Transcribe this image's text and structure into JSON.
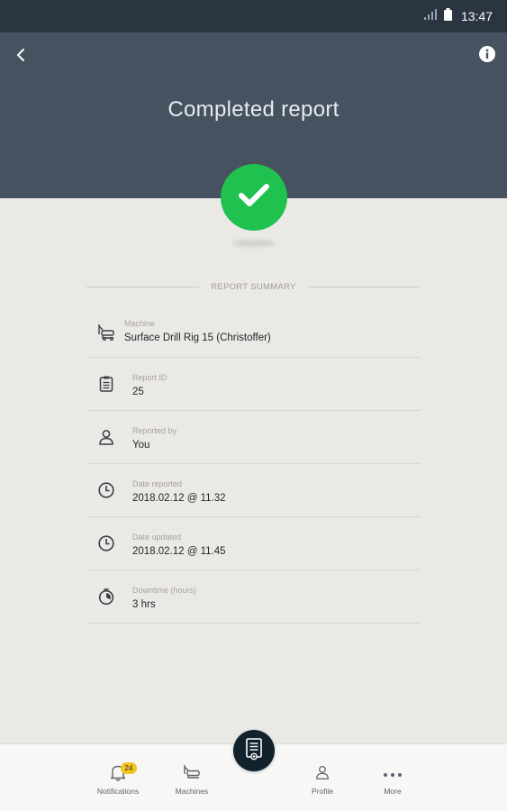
{
  "status_bar": {
    "time": "13:47"
  },
  "header": {
    "title": "Completed report"
  },
  "colors": {
    "header_bg": "#46525f",
    "status_bar_bg": "#2a3541",
    "success_green": "#1fc14f",
    "badge_yellow": "#f3c524",
    "fab_bg": "#12222d"
  },
  "summary": {
    "section_label": "REPORT SUMMARY",
    "rows": [
      {
        "icon": "drill-rig-icon",
        "label": "Machine",
        "value": "Surface Drill Rig 15 (Christoffer)"
      },
      {
        "icon": "clipboard-icon",
        "label": "Report ID",
        "value": "25"
      },
      {
        "icon": "person-icon",
        "label": "Reported by",
        "value": "You"
      },
      {
        "icon": "clock-icon",
        "label": "Date reported",
        "value": "2018.02.12 @ 11.32"
      },
      {
        "icon": "clock-icon",
        "label": "Date updated",
        "value": "2018.02.12 @ 11.45"
      },
      {
        "icon": "stopwatch-icon",
        "label": "Downtime (hours)",
        "value": "3 hrs"
      }
    ]
  },
  "bottom_nav": {
    "notifications": {
      "label": "Notifications",
      "badge": "24"
    },
    "machines": {
      "label": "Machines"
    },
    "profile": {
      "label": "Profile"
    },
    "more": {
      "label": "More"
    }
  }
}
